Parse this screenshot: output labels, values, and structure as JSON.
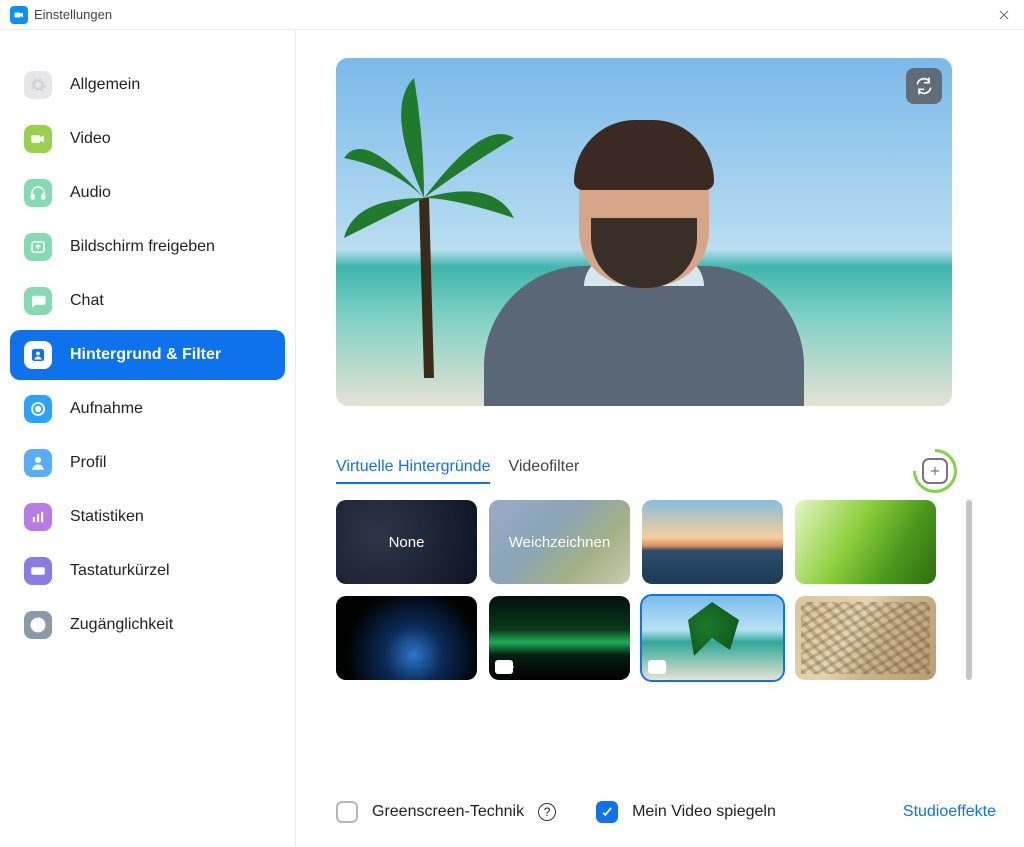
{
  "window": {
    "title": "Einstellungen"
  },
  "sidebar": {
    "items": [
      {
        "id": "general",
        "label": "Allgemein",
        "icon": "gear",
        "color": "#e7e7e9",
        "fg": "#bfbfc2"
      },
      {
        "id": "video",
        "label": "Video",
        "icon": "video",
        "color": "#9ad04d",
        "fg": "#ffffff"
      },
      {
        "id": "audio",
        "label": "Audio",
        "icon": "headset",
        "color": "#86dab2",
        "fg": "#ffffff"
      },
      {
        "id": "share",
        "label": "Bildschirm freigeben",
        "icon": "share",
        "color": "#86dab2",
        "fg": "#ffffff"
      },
      {
        "id": "chat",
        "label": "Chat",
        "icon": "chat",
        "color": "#86dab2",
        "fg": "#ffffff"
      },
      {
        "id": "background",
        "label": "Hintergrund & Filter",
        "icon": "person",
        "color": "#ffffff",
        "fg": "#0e72ed",
        "active": true
      },
      {
        "id": "record",
        "label": "Aufnahme",
        "icon": "record",
        "color": "#2aa3ff",
        "fg": "#ffffff"
      },
      {
        "id": "profile",
        "label": "Profil",
        "icon": "profile",
        "color": "#58aef6",
        "fg": "#ffffff"
      },
      {
        "id": "stats",
        "label": "Statistiken",
        "icon": "stats",
        "color": "#b97be6",
        "fg": "#ffffff"
      },
      {
        "id": "shortcuts",
        "label": "Tastaturkürzel",
        "icon": "keyboard",
        "color": "#8a7be6",
        "fg": "#ffffff"
      },
      {
        "id": "a11y",
        "label": "Zugänglichkeit",
        "icon": "a11y",
        "color": "#8a9aa7",
        "fg": "#ffffff"
      }
    ]
  },
  "tabs": {
    "virtual_bg": "Virtuelle Hintergründe",
    "video_filter": "Videofilter",
    "active": "virtual_bg"
  },
  "thumbs": {
    "none": "None",
    "blur": "Weichzeichnen",
    "selected_index": 6
  },
  "footer": {
    "greenscreen": {
      "label": "Greenscreen-Technik",
      "checked": false
    },
    "mirror": {
      "label": "Mein Video spiegeln",
      "checked": true
    },
    "studio": "Studioeffekte"
  }
}
